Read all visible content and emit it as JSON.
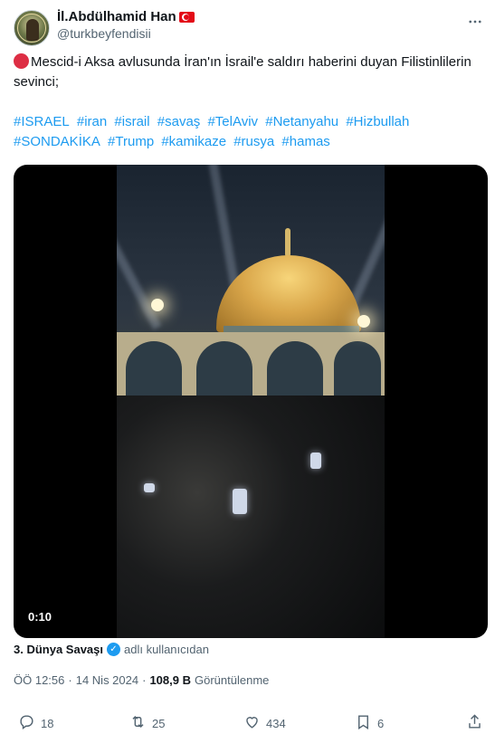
{
  "tweet": {
    "display_name": "İl.Abdülhamid Han",
    "handle": "@turkbeyfendisii",
    "text": "Mescid-i Aksa avlusunda İran'ın İsrail'e saldırı haberini duyan Filistinlilerin sevinci;",
    "hashtags": [
      "#ISRAEL",
      "#iran",
      "#israil",
      "#savaş",
      "#TelAviv",
      "#Netanyahu",
      "#Hizbullah",
      "#SONDAKİKA",
      "#Trump",
      "#kamikaze",
      "#rusya",
      "#hamas"
    ]
  },
  "media": {
    "duration": "0:10"
  },
  "attribution": {
    "name": "3. Dünya Savaşı",
    "suffix": "adlı kullanıcıdan"
  },
  "meta": {
    "time": "ÖÖ 12:56",
    "separator1": "·",
    "date": "14 Nis 2024",
    "separator2": "·",
    "views_count": "108,9 B",
    "views_label": "Görüntülenme"
  },
  "actions": {
    "replies": "18",
    "reposts": "25",
    "likes": "434",
    "bookmarks": "6"
  },
  "icons": {
    "more": "more-icon",
    "reply": "reply-icon",
    "repost": "repost-icon",
    "like": "like-icon",
    "bookmark": "bookmark-icon",
    "share": "share-icon",
    "verified": "verified-icon"
  },
  "colors": {
    "link": "#1d9bf0",
    "secondary_text": "#536471",
    "primary_text": "#0f1419"
  }
}
